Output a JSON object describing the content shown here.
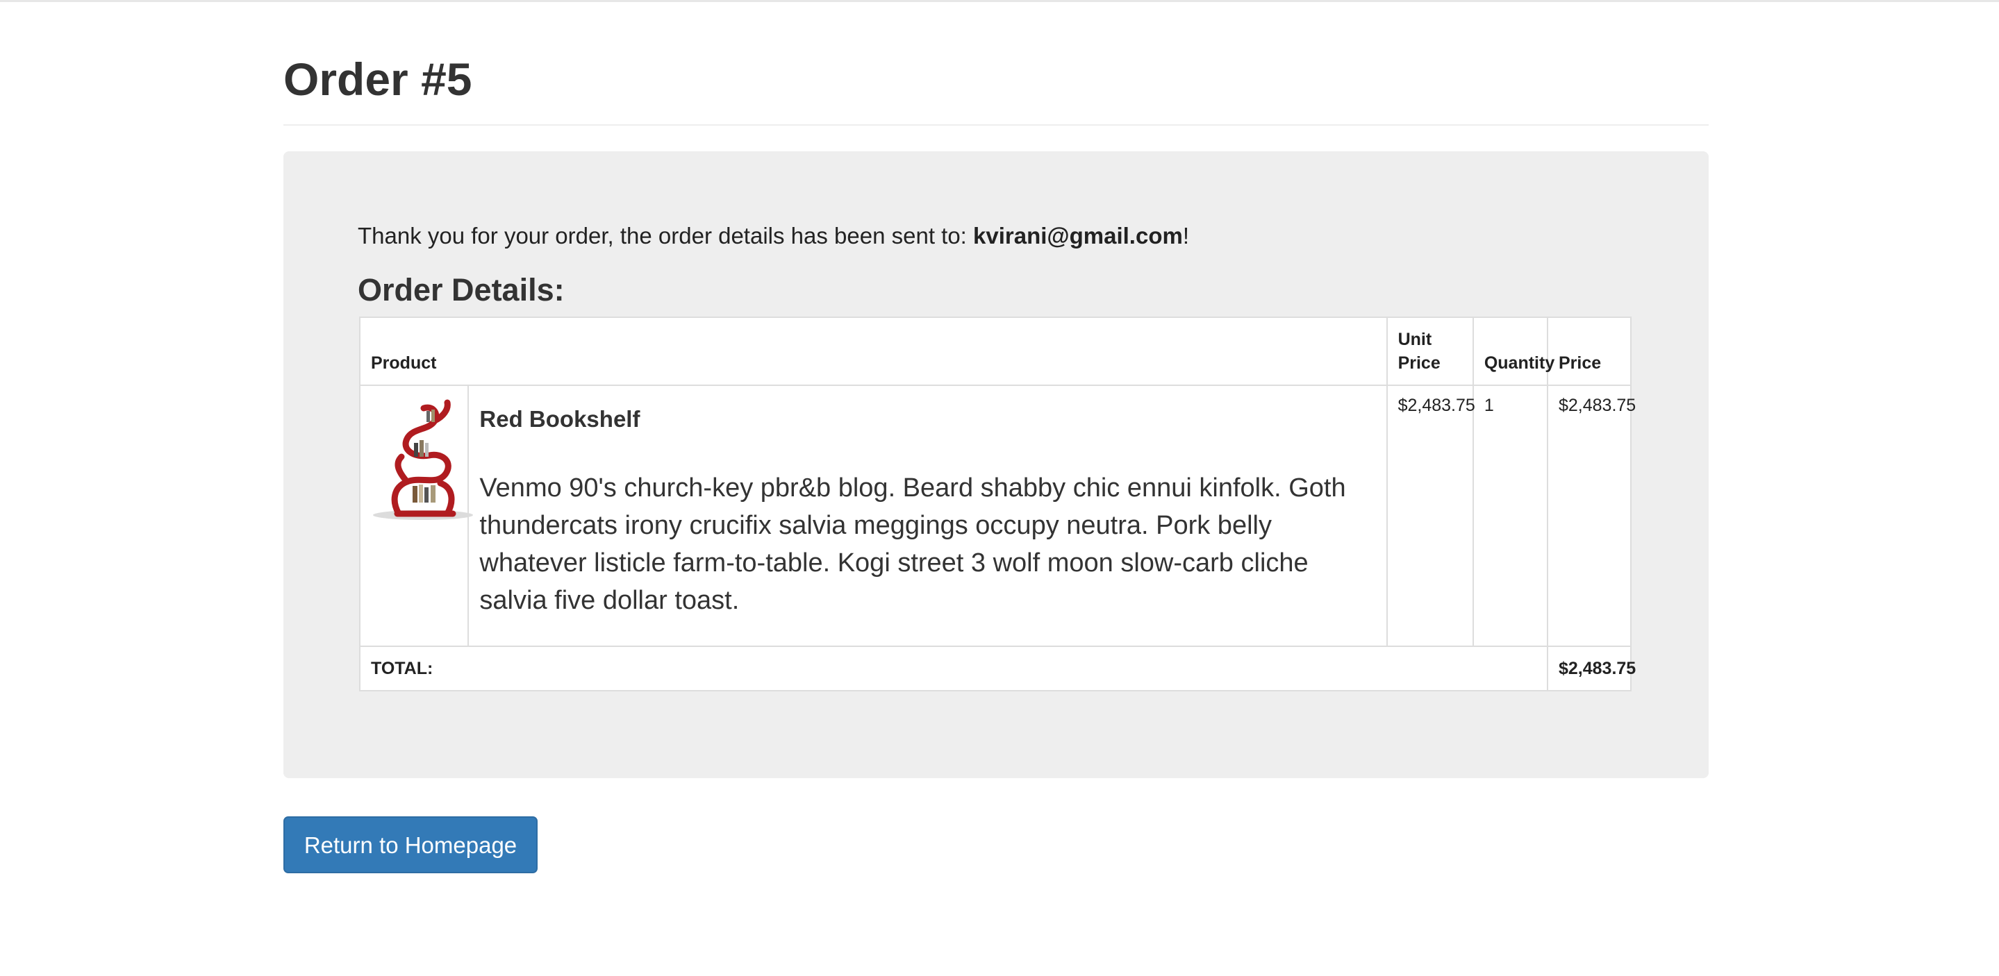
{
  "page": {
    "title": "Order #5"
  },
  "confirmation": {
    "prefix": "Thank you for your order, the order details has been sent to: ",
    "email": "kvirani@gmail.com",
    "suffix": "!"
  },
  "details": {
    "heading": "Order Details:",
    "columns": {
      "product": "Product",
      "unit_price": "Unit Price",
      "quantity": "Quantity",
      "price": "Price"
    },
    "items": [
      {
        "name": "Red Bookshelf",
        "description": "Venmo 90's church-key pbr&b blog. Beard shabby chic ennui kinfolk. Goth thundercats irony crucifix salvia meggings occupy neutra. Pork belly whatever listicle farm-to-table. Kogi street 3 wolf moon slow-carb cliche salvia five dollar toast.",
        "unit_price": "$2,483.75",
        "quantity": "1",
        "price": "$2,483.75"
      }
    ],
    "total_label": "TOTAL:",
    "total_value": "$2,483.75"
  },
  "actions": {
    "return_label": "Return to Homepage"
  },
  "colors": {
    "accent": "#337ab7",
    "well": "#eeeeee",
    "product": "#b01c20"
  }
}
